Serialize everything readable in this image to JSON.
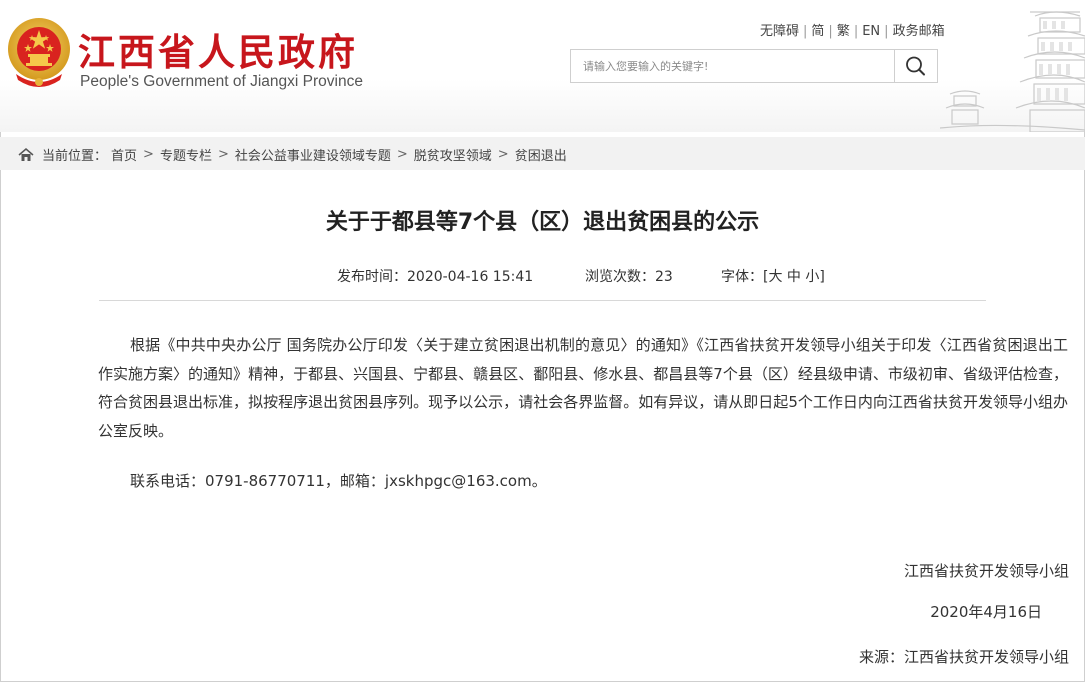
{
  "header": {
    "title_cn": "江西省人民政府",
    "title_en": "People's Government of Jiangxi Province",
    "links": [
      "无障碍",
      "简",
      "繁",
      "EN",
      "政务邮箱"
    ],
    "search_placeholder": "请输入您要输入的关键字!"
  },
  "breadcrumb": {
    "label": "当前位置：",
    "items": [
      "首页",
      "专题专栏",
      "社会公益事业建设领域专题",
      "脱贫攻坚领域",
      "贫困退出"
    ]
  },
  "article": {
    "title": "关于于都县等7个县（区）退出贫困县的公示",
    "publish_label": "发布时间：2020-04-16 15:41",
    "views_label": "浏览次数：23",
    "font_label": "字体：",
    "font_sizes": [
      "大",
      "中",
      "小"
    ],
    "body": "根据《中共中央办公厅 国务院办公厅印发〈关于建立贫困退出机制的意见〉的通知》《江西省扶贫开发领导小组关于印发〈江西省贫困退出工作实施方案〉的通知》精神，于都县、兴国县、宁都县、赣县区、鄱阳县、修水县、都昌县等7个县（区）经县级申请、市级初审、省级评估检查，符合贫困县退出标准，拟按程序退出贫困县序列。现予以公示，请社会各界监督。如有异议，请从即日起5个工作日内向江西省扶贫开发领导小组办公室反映。",
    "contact": "联系电话：0791-86770711，邮箱：jxskhpgc@163.com。",
    "signature": "江西省扶贫开发领导小组",
    "date": "2020年4月16日",
    "source": "来源：江西省扶贫开发领导小组"
  },
  "colors": {
    "brand_red": "#c7161c",
    "emblem_gold": "#e8b33a"
  },
  "icons": [
    "national-emblem-icon",
    "search-icon",
    "home-icon",
    "pagoda-illustration"
  ]
}
